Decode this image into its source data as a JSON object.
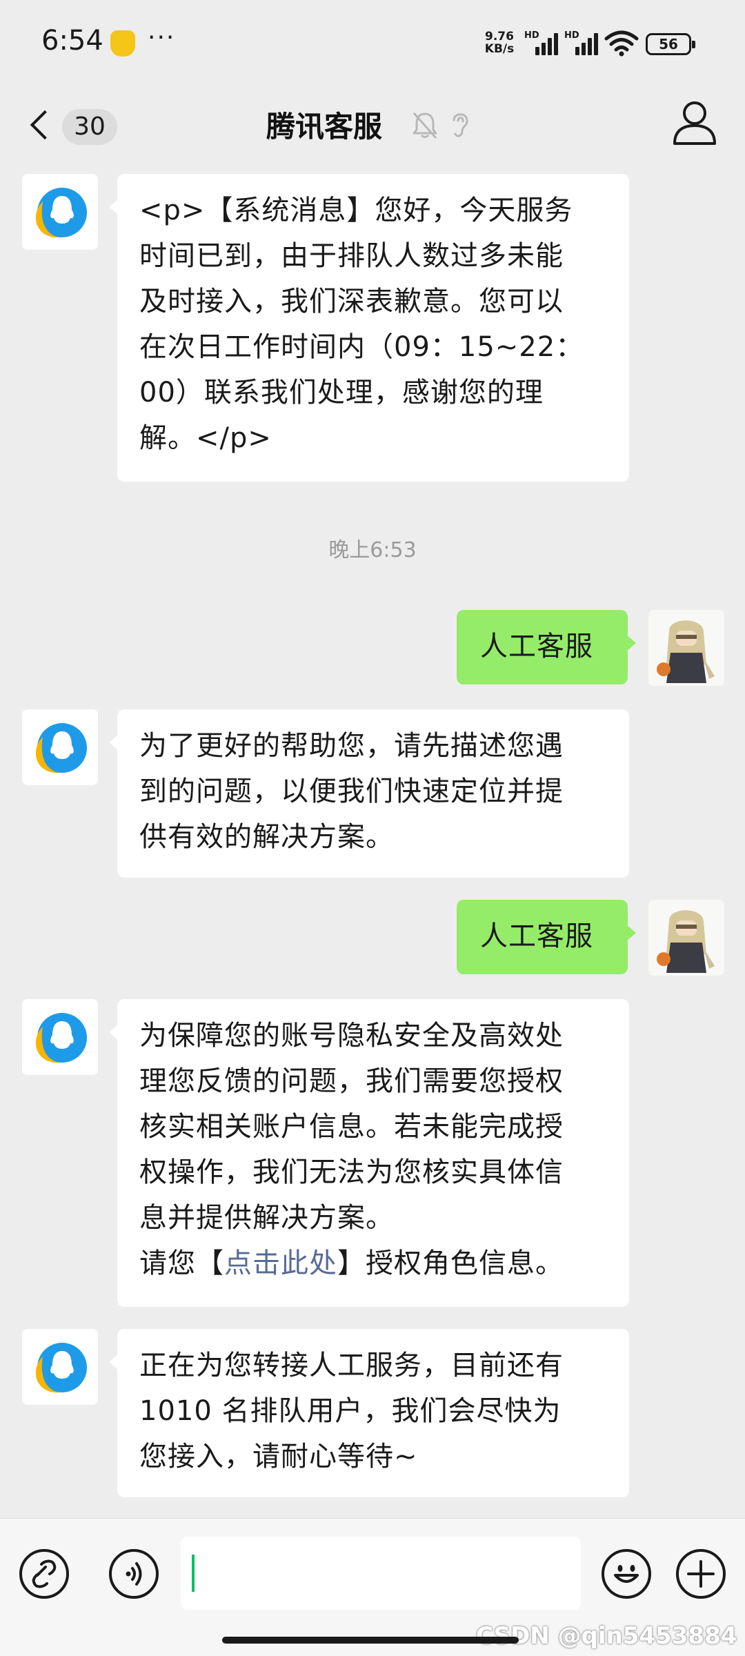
{
  "status_bar": {
    "time": "6:54",
    "more": "···",
    "net_speed_value": "9.76",
    "net_speed_unit": "KB/s",
    "hd_label_1": "HD",
    "hd_label_2": "HD",
    "battery": "56"
  },
  "nav": {
    "unread_count": "30",
    "title": "腾讯客服"
  },
  "messages": [
    {
      "side": "left",
      "lines": [
        "<p>【系统消息】您好，今天服务",
        "时间已到，由于排队人数过多未能",
        "及时接入，我们深表歉意。您可以",
        "在次日工作时间内（09：15~22：",
        "00）联系我们处理，感谢您的理",
        "解。</p>"
      ]
    },
    {
      "time_divider": "晚上6:53"
    },
    {
      "side": "right",
      "text": "人工客服"
    },
    {
      "side": "left",
      "lines": [
        "为了更好的帮助您，请先描述您遇",
        "到的问题，以便我们快速定位并提",
        "供有效的解决方案。"
      ]
    },
    {
      "side": "right",
      "text": "人工客服"
    },
    {
      "side": "left",
      "lines": [
        "为保障您的账号隐私安全及高效处",
        "理您反馈的问题，我们需要您授权",
        "核实相关账户信息。若未能完成授",
        "权操作，我们无法为您核实具体信",
        "息并提供解决方案。"
      ],
      "link_prefix": "请您【",
      "link_text": "点击此处",
      "link_suffix": "】授权角色信息。"
    },
    {
      "side": "left",
      "lines": [
        "正在为您转接人工服务，目前还有",
        "1010 名排队用户，我们会尽快为",
        "您接入，请耐心等待~"
      ]
    }
  ],
  "watermark": "CSDN @qin5453884",
  "icons": {
    "mute": "bell-off-icon",
    "ear": "ear-icon",
    "profile": "person-icon",
    "link": "mini-program-link-icon",
    "voice": "voice-icon",
    "emoji": "emoji-icon",
    "plus": "plus-icon"
  },
  "colors": {
    "background": "#ededed",
    "sent_bubble": "#95ec69",
    "received_bubble": "#ffffff",
    "link": "#576b95",
    "caret": "#07c160"
  }
}
